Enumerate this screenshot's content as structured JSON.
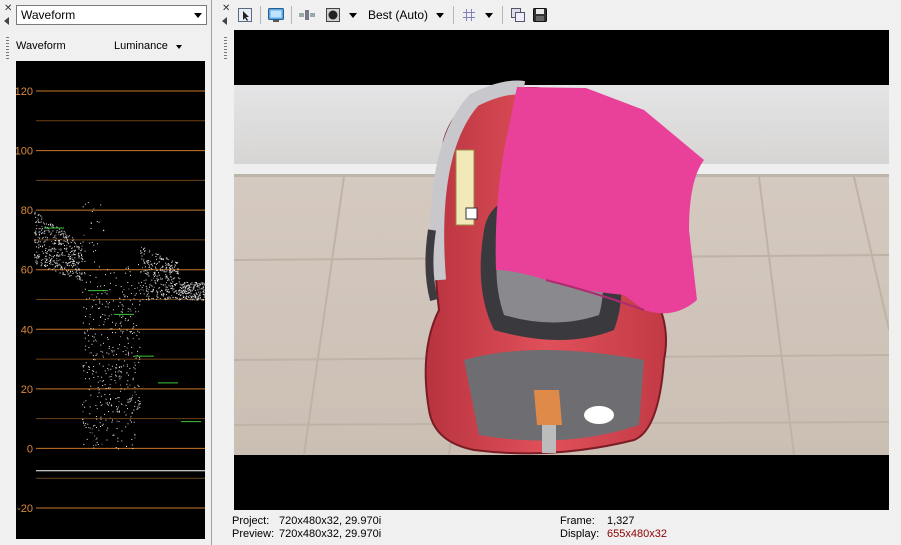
{
  "scopes": {
    "type_select": "Waveform",
    "title": "Waveform",
    "mode": "Luminance",
    "y_ticks": [
      120,
      100,
      80,
      60,
      40,
      20,
      0,
      -20
    ],
    "grid_color": "#c8782a",
    "label_color": "#d88a3c"
  },
  "preview": {
    "quality": "Best (Auto)"
  },
  "status": {
    "project_label": "Project:",
    "project_value": "720x480x32, 29.970i",
    "preview_label": "Preview:",
    "preview_value": "720x480x32, 29.970i",
    "frame_label": "Frame:",
    "frame_value": "1,327",
    "display_label": "Display:",
    "display_value": "655x480x32"
  },
  "icons": {
    "close": "close-icon",
    "collapse": "collapse-arrow-icon",
    "select_tool": "select-tool-icon",
    "preview_monitor": "preview-monitor-icon",
    "split_screen": "split-screen-icon",
    "overlay": "overlay-icon",
    "grid": "grid-icon",
    "copy_snapshot": "copy-snapshot-icon",
    "save_snapshot": "save-snapshot-icon"
  }
}
